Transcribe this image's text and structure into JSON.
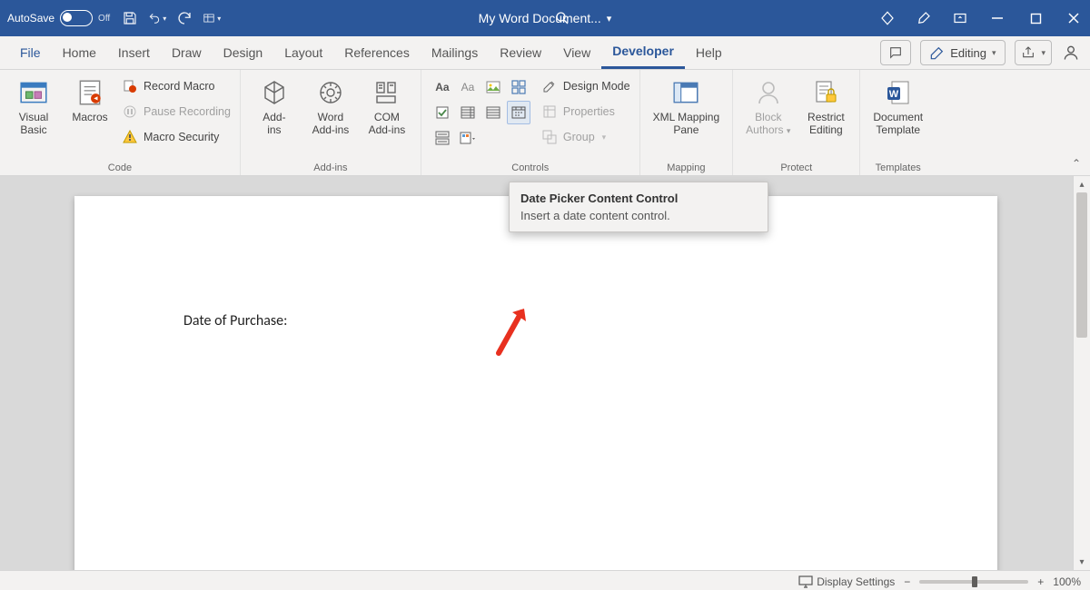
{
  "titlebar": {
    "autosave_label": "AutoSave",
    "autosave_state": "Off",
    "doc_title": "My Word Document..."
  },
  "tabs": {
    "items": [
      "File",
      "Home",
      "Insert",
      "Draw",
      "Design",
      "Layout",
      "References",
      "Mailings",
      "Review",
      "View",
      "Developer",
      "Help"
    ],
    "active": "Developer",
    "editing_label": "Editing"
  },
  "ribbon": {
    "code": {
      "label": "Code",
      "visual_basic": "Visual\nBasic",
      "macros": "Macros",
      "record_macro": "Record Macro",
      "pause_recording": "Pause Recording",
      "macro_security": "Macro Security"
    },
    "addins": {
      "label": "Add-ins",
      "addins": "Add-\nins",
      "word_addins": "Word\nAdd-ins",
      "com_addins": "COM\nAdd-ins"
    },
    "controls": {
      "label": "Controls",
      "design_mode": "Design Mode",
      "properties": "Properties",
      "group": "Group"
    },
    "mapping": {
      "label": "Mapping",
      "xml_mapping": "XML Mapping\nPane"
    },
    "protect": {
      "label": "Protect",
      "block_authors": "Block\nAuthors",
      "restrict_editing": "Restrict\nEditing"
    },
    "templates": {
      "label": "Templates",
      "document_template": "Document\nTemplate"
    }
  },
  "tooltip": {
    "title": "Date Picker Content Control",
    "body": "Insert a date content control."
  },
  "document": {
    "text": "Date of Purchase:"
  },
  "statusbar": {
    "display_settings": "Display Settings",
    "zoom": "100%"
  }
}
